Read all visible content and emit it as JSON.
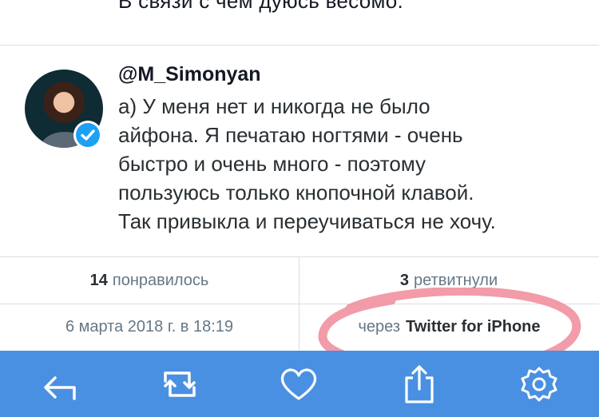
{
  "previous_tweet": {
    "text": "В связи с чем дуюсь весомо."
  },
  "tweet": {
    "handle": "@M_Simonyan",
    "text_lines": [
      "а) У меня нет и никогда не было",
      "айфона. Я печатаю ногтями - очень",
      "быстро и очень много - поэтому",
      "пользуюсь только кнопочной клавой.",
      "Так привыкла и переучиваться не хочу."
    ],
    "avatar_icon": "profile-photo",
    "verified_icon": "verified-badge-icon"
  },
  "stats": {
    "likes_count": "14",
    "likes_label": "понравилось",
    "retweets_count": "3",
    "retweets_label": "ретвитнули"
  },
  "meta": {
    "timestamp": "6 марта 2018 г. в 18:19",
    "via_label": "через",
    "client": "Twitter for iPhone"
  },
  "toolbar": {
    "background": "#4a90e2",
    "icons": [
      "reply-icon",
      "retweet-icon",
      "heart-icon",
      "share-icon",
      "settings-icon"
    ]
  },
  "annotation": {
    "color": "#f08a9a",
    "shape": "hand-drawn-ellipse"
  }
}
